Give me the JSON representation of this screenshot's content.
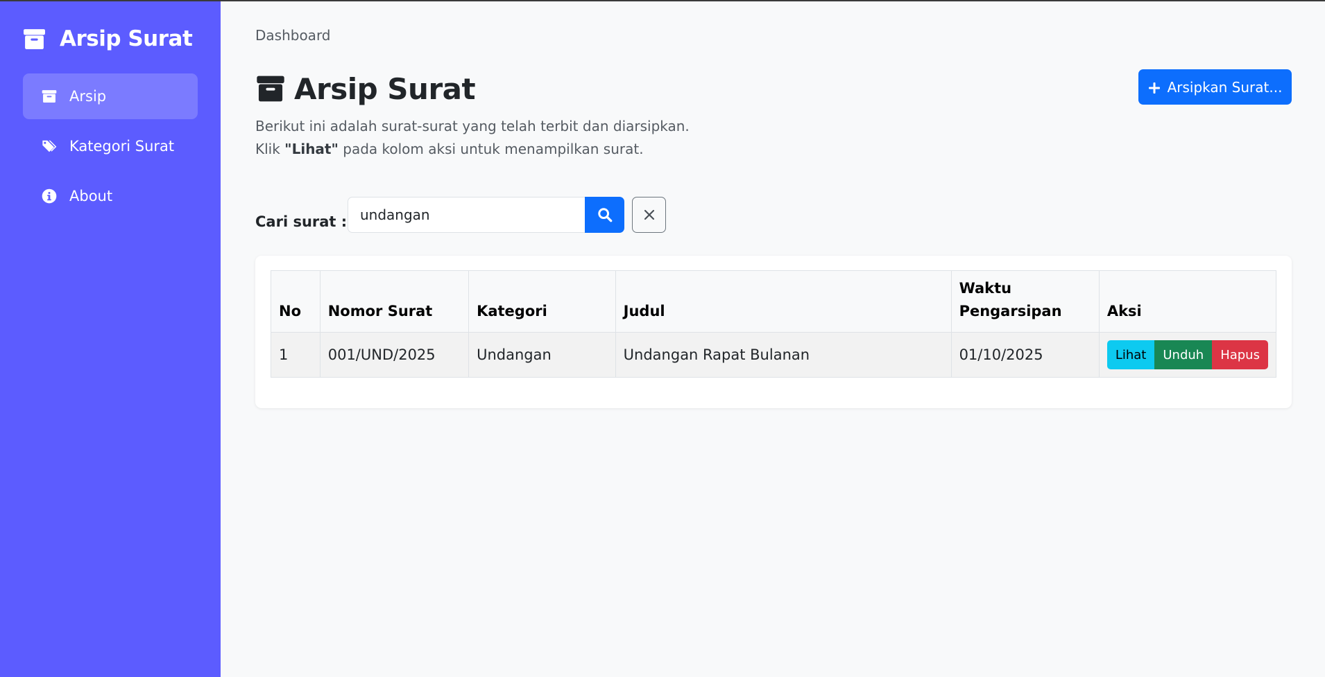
{
  "sidebar": {
    "brand": "Arsip Surat",
    "items": [
      {
        "label": "Arsip",
        "icon": "archive-icon",
        "active": true
      },
      {
        "label": "Kategori Surat",
        "icon": "tags-icon",
        "active": false
      },
      {
        "label": "About",
        "icon": "info-circle-icon",
        "active": false
      }
    ]
  },
  "header": {
    "breadcrumb": "Dashboard",
    "title": "Arsip Surat",
    "description_line1": "Berikut ini adalah surat-surat yang telah terbit dan diarsipkan.",
    "description_line2_pre": "Klik ",
    "description_line2_bold": "\"Lihat\"",
    "description_line2_post": " pada kolom aksi untuk menampilkan surat.",
    "add_button_label": "Arsipkan Surat..."
  },
  "search": {
    "label": "Cari surat :",
    "value": "undangan",
    "search_icon": "search-icon",
    "clear_icon": "close-icon"
  },
  "table": {
    "columns": [
      "No",
      "Nomor Surat",
      "Kategori",
      "Judul",
      "Waktu Pengarsipan",
      "Aksi"
    ],
    "rows": [
      {
        "no": "1",
        "nomor_surat": "001/UND/2025",
        "kategori": "Undangan",
        "judul": "Undangan Rapat Bulanan",
        "waktu": "01/10/2025",
        "actions": {
          "view": "Lihat",
          "download": "Unduh",
          "delete": "Hapus"
        }
      }
    ]
  },
  "colors": {
    "sidebar_bg": "#5c5cff",
    "sidebar_active": "#7b7bff",
    "primary": "#0d6efd",
    "info": "#0dcaf0",
    "success": "#198754",
    "danger": "#dc3545"
  }
}
